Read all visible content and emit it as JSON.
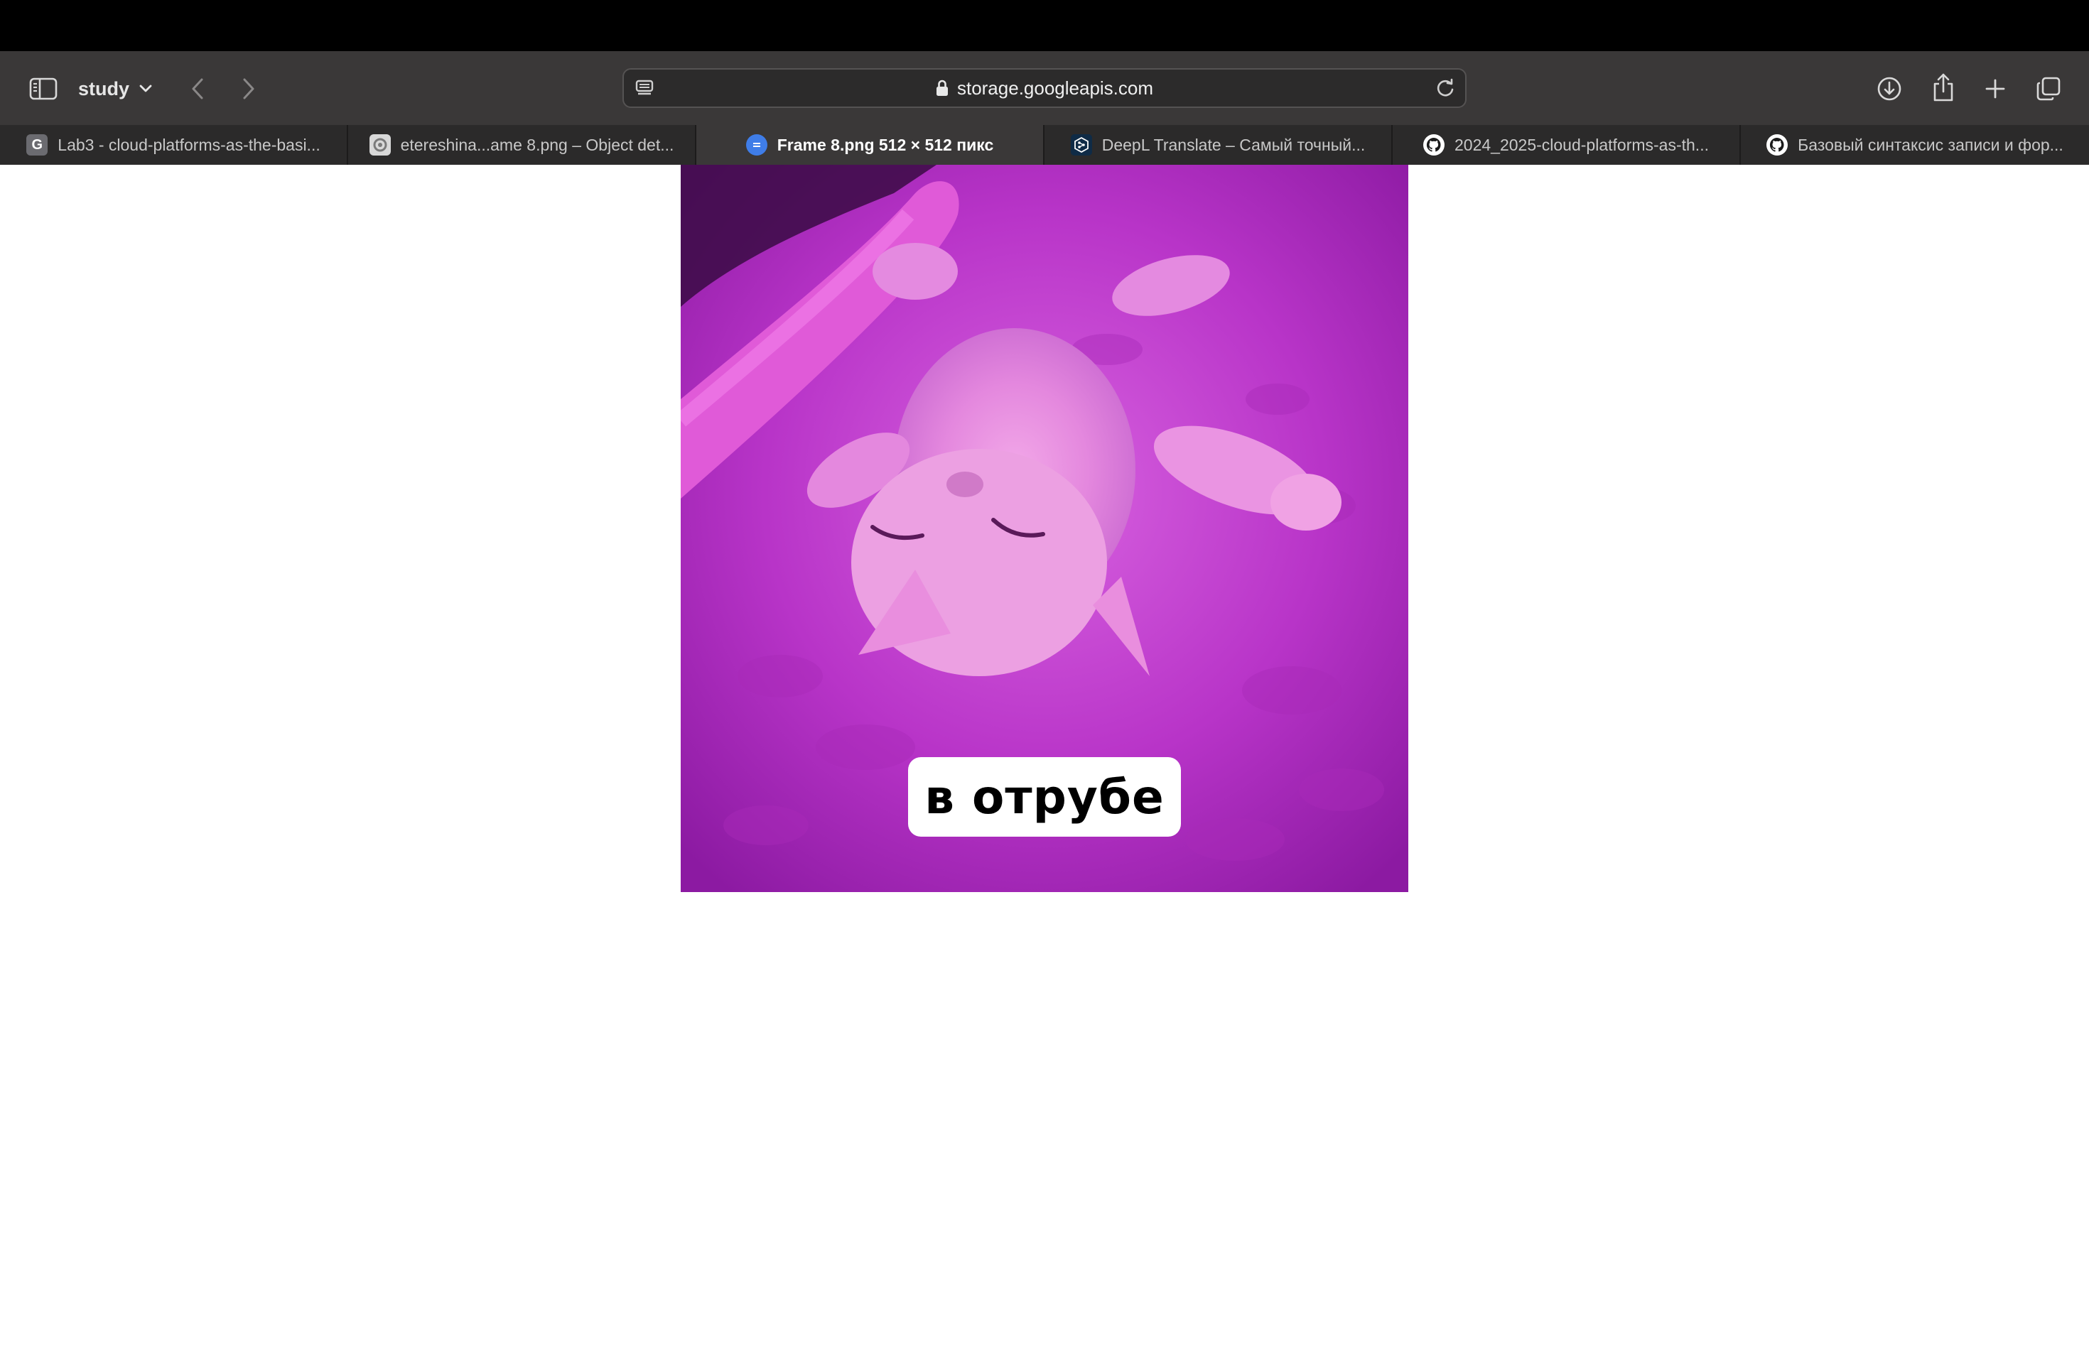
{
  "toolbar": {
    "profile_name": "study",
    "url": "storage.googleapis.com"
  },
  "tabs": [
    {
      "label": "Lab3 - cloud-platforms-as-the-basi...",
      "icon": "g-letter-icon",
      "favicon_letter": "G",
      "active": false
    },
    {
      "label": "etereshina...ame 8.png – Object det...",
      "icon": "google-cloud-icon",
      "active": false
    },
    {
      "label": "Frame 8.png 512 × 512 пикс",
      "icon": "cloud-storage-icon",
      "active": true
    },
    {
      "label": "DeepL Translate – Самый точный...",
      "icon": "deepl-icon",
      "active": false
    },
    {
      "label": "2024_2025-cloud-platforms-as-th...",
      "icon": "github-icon",
      "active": false
    },
    {
      "label": "Базовый синтаксис записи и фор...",
      "icon": "github-icon",
      "active": false
    }
  ],
  "image": {
    "caption": "в отрубе",
    "colors": {
      "tint": "#c040d0",
      "caption_bg": "#ffffff"
    }
  },
  "colors": {
    "toolbar_bg": "#3a3838",
    "tabbar_bg": "#2b2a2a",
    "active_tab_bg": "#3a3838",
    "page_bg": "#ffffff"
  }
}
